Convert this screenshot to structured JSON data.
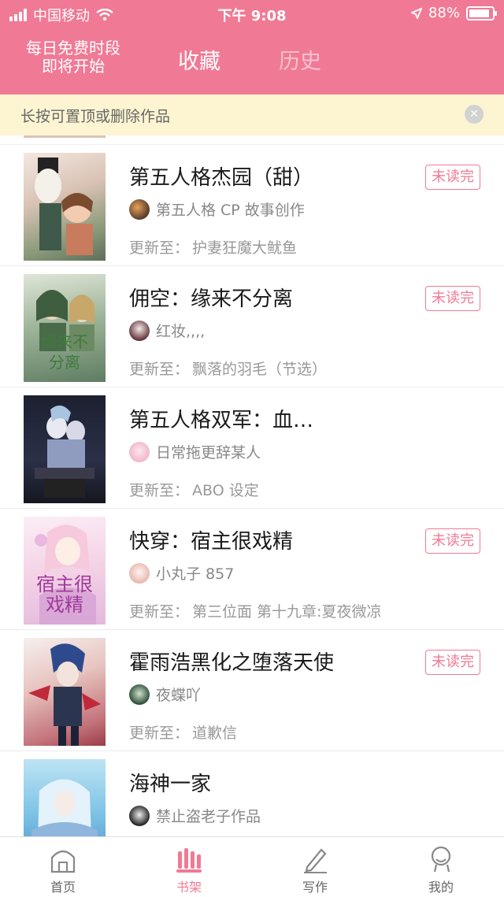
{
  "status_bar": {
    "carrier": "中国移动",
    "time": "下午 9:08",
    "battery": "88%",
    "battery_level": 0.88
  },
  "header": {
    "promo": [
      "每日免费时段",
      "即将开始"
    ],
    "tabs": [
      {
        "label": "收藏",
        "active": true
      },
      {
        "label": "历史",
        "active": false
      }
    ]
  },
  "notice": {
    "text": "长按可置顶或删除作品",
    "close_icon": "close-icon"
  },
  "update_prefix": "更新至：",
  "colors": {
    "accent": "#f07a95",
    "notice_bg": "#fdf5d2"
  },
  "items": [
    {
      "title": "第五人格杰园（甜）",
      "badge": "未读完",
      "author": "第五人格 CP 故事创作",
      "update": "护妻狂魔大鱿鱼",
      "cover_text": ""
    },
    {
      "title": "佣空：缘来不分离",
      "badge": "未读完",
      "author": "红妆,,,,",
      "update": "飘落的羽毛（节选）",
      "cover_text": "缘来不分离"
    },
    {
      "title": "第五人格双军：血…",
      "badge": "",
      "author": "日常拖更辞某人",
      "update": "ABO 设定",
      "cover_text": ""
    },
    {
      "title": "快穿：宿主很戏精",
      "badge": "未读完",
      "author": "小丸子 857",
      "update": "第三位面  第十九章:夏夜微凉",
      "cover_text": "宿主很戏精"
    },
    {
      "title": "霍雨浩黑化之堕落天使",
      "badge": "未读完",
      "author": "夜蝶吖",
      "update": "道歉信",
      "cover_text": ""
    },
    {
      "title": "海神一家",
      "badge": "",
      "author": "禁止盗老子作品",
      "update": "",
      "cover_text": ""
    }
  ],
  "tabbar": [
    {
      "label": "首页",
      "icon": "home-icon",
      "active": false
    },
    {
      "label": "书架",
      "icon": "bookshelf-icon",
      "active": true
    },
    {
      "label": "写作",
      "icon": "pen-icon",
      "active": false
    },
    {
      "label": "我的",
      "icon": "profile-icon",
      "active": false
    }
  ]
}
